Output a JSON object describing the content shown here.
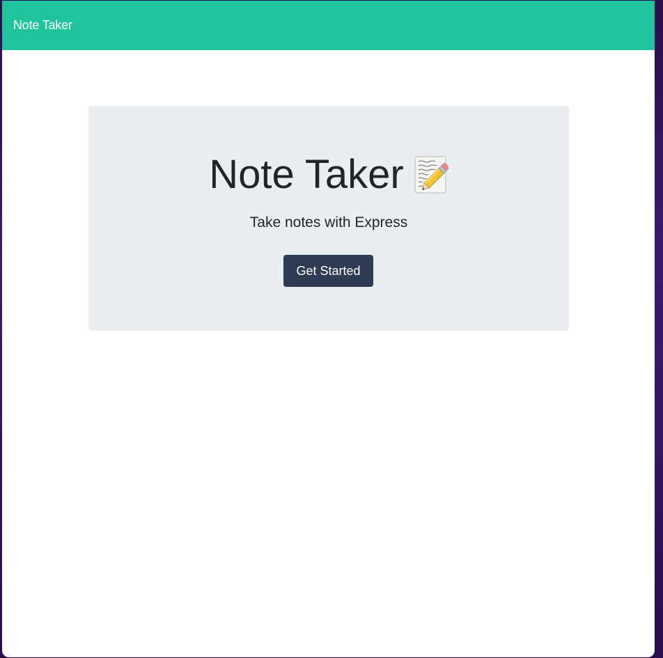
{
  "navbar": {
    "brand": "Note Taker"
  },
  "hero": {
    "title": "Note Taker",
    "title_icon": "memo-icon",
    "subtitle": "Take notes with Express",
    "cta_label": "Get Started"
  },
  "colors": {
    "navbar_bg": "#20c39c",
    "hero_bg": "#ebeef0",
    "button_bg": "#2f3a53",
    "text": "#212529"
  }
}
